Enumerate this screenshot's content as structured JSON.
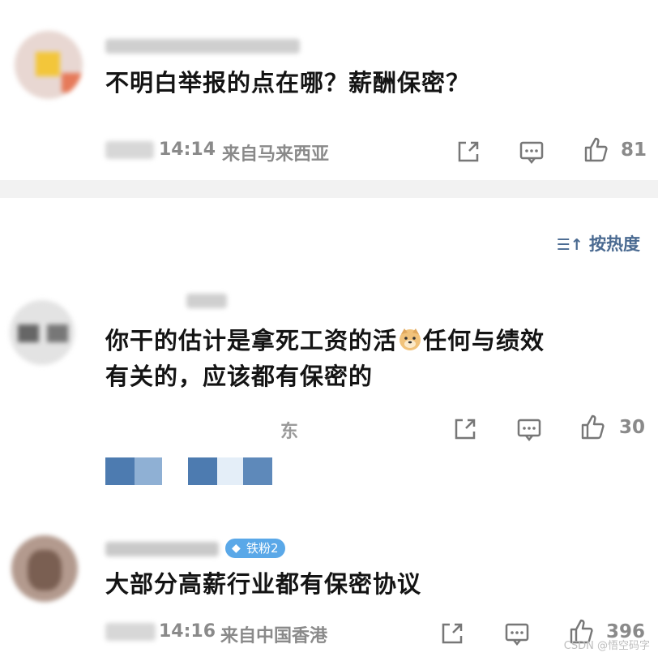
{
  "comments": [
    {
      "text": "不明白举报的点在哪？薪酬保密？",
      "time": "14:14",
      "location": "来自马来西亚",
      "likes": "81"
    },
    {
      "text_before_emoji": "你干的估计是拿死工资的活",
      "text_after_emoji": "任何与绩效",
      "text_line2": "有关的，应该都有保密的",
      "location_fragment": "东",
      "likes": "30"
    },
    {
      "badge": "铁粉2",
      "text": "大部分高薪行业都有保密协议",
      "time": "14:16",
      "location": "来自中国香港",
      "likes": "396"
    }
  ],
  "sort_label": "按热度",
  "watermark": "CSDN @悟空码字",
  "icons": [
    "share-icon",
    "comment-icon",
    "like-icon",
    "sort-icon",
    "doge-emoji"
  ]
}
